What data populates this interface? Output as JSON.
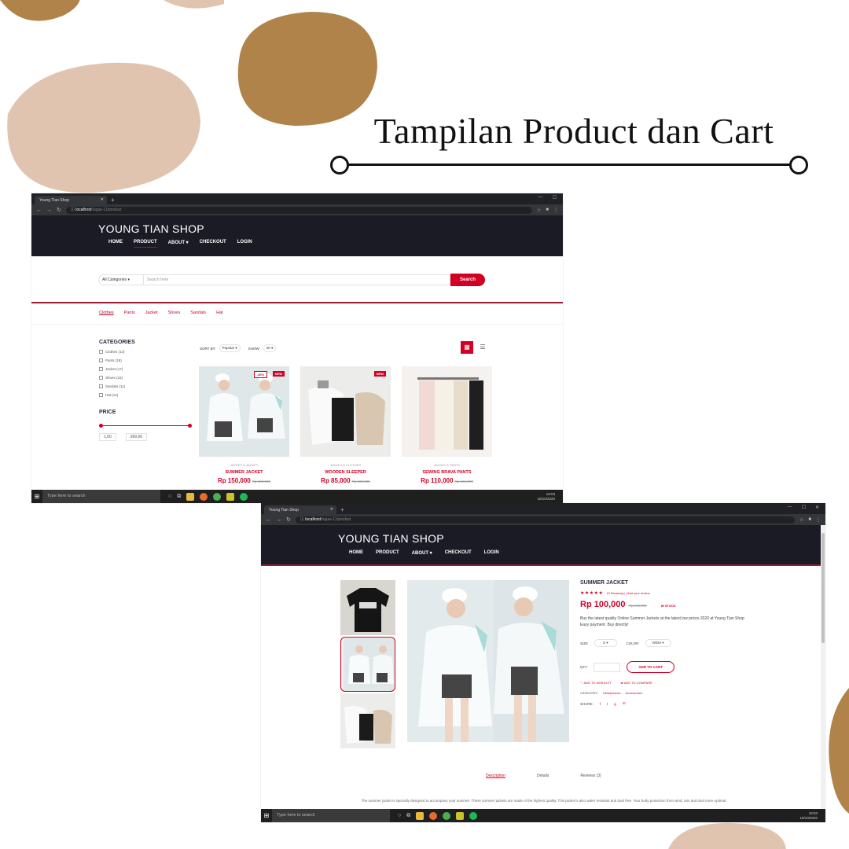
{
  "heading": "Tampilan Product dan Cart",
  "colors": {
    "accent": "#d10024",
    "navbar": "#1b1b26",
    "blob_tan": "#e1c4b0",
    "blob_brown": "#b0834b"
  },
  "browser": {
    "tab_title": "Young Tian Shop",
    "url_host": "localhost",
    "url_path": "/tugas-11/product"
  },
  "taskbar": {
    "search_placeholder": "Type here to search",
    "time": "19:03",
    "date": "18/10/2020"
  },
  "shop": {
    "brand": "YOUNG TIAN SHOP",
    "menu": [
      "HOME",
      "PRODUCT",
      "ABOUT ▾",
      "CHECKOUT",
      "LOGIN"
    ],
    "active_menu": "PRODUCT"
  },
  "product_page": {
    "search": {
      "category": "All Categories",
      "placeholder": "Search here",
      "button": "Search"
    },
    "subnav": [
      "Clothes",
      "Pants",
      "Jacket",
      "Shoes",
      "Sandals",
      "Hat"
    ],
    "categories_title": "CATEGORIES",
    "categories": [
      "Clothes (12)",
      "Pants (18)",
      "Jacket (17)",
      "Shoes (15)",
      "Sandals (11)",
      "Hat (14)"
    ],
    "price_title": "PRICE",
    "price_min": "1,00",
    "price_max": "999,00",
    "sort_label": "SORT BY:",
    "sort_value": "Popular",
    "show_label": "SHOW:",
    "show_value": "20",
    "products": [
      {
        "category": "JACKET & JACKET",
        "name": "SUMMER JACKET",
        "price": "Rp 150,000",
        "old_price": "Rp 200,000",
        "sale": "-30%",
        "new": "NEW"
      },
      {
        "category": "JACKET & CLOTHES",
        "name": "WOODEN SLEEPER",
        "price": "Rp 85,000",
        "old_price": "Rp 100,000",
        "sale": "",
        "new": "NEW"
      },
      {
        "category": "JACKET & PANTS",
        "name": "SEWING BRAVA PANTS",
        "price": "Rp 110,000",
        "old_price": "Rp 135,000",
        "sale": "",
        "new": ""
      }
    ]
  },
  "detail_page": {
    "name": "SUMMER JACKET",
    "stars": "★★★★★",
    "reviews": "10 Review(s) | Add your review",
    "price": "Rp 100,000",
    "old_price": "Rp 150,000",
    "stock": "IN STOCK",
    "description": "Buy the latest quality Online Summer Jackets at the latest low prices 2020 at Young Tian Shop Easy payment. Buy directly!",
    "size_label": "SIZE",
    "size_value": "S",
    "color_label": "COLOR",
    "color_value": "White",
    "qty_label": "QTY",
    "add_to_cart": "ADD TO CART",
    "wishlist": "ADD TO WISHLIST",
    "compare": "ADD TO COMPARE",
    "category_label": "CATEGORY:",
    "category_values": [
      "Headphones",
      "Accessories"
    ],
    "share_label": "SHARE:",
    "tabs": [
      "Description",
      "Details",
      "Reviews (3)"
    ],
    "active_tab": "Description",
    "desc_text": "The summer jacket is specially designed to accompany your summer. These summer jackets are made of the highest quality. This jacket is also water resistant and dust free. Your body protection from wind, rain and dust more optimal."
  }
}
